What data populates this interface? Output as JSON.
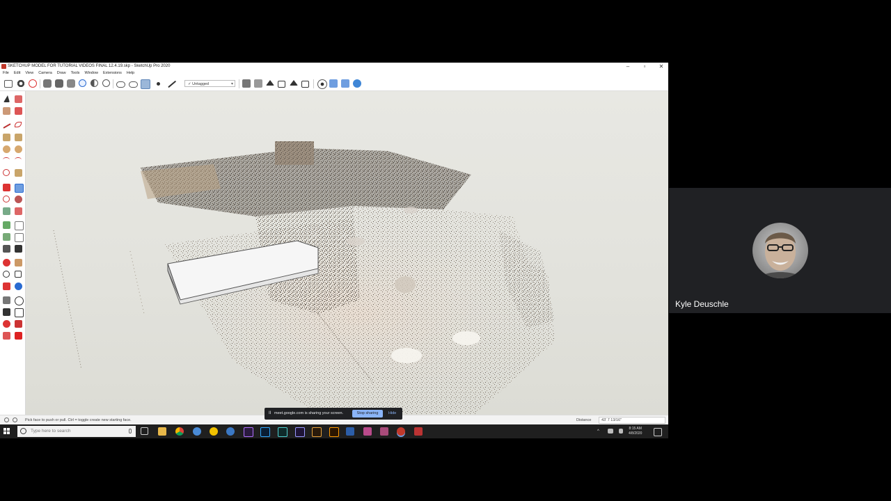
{
  "window": {
    "title": "SKETCHUP MODEL FOR TUTORIAL VIDEOS FINAL 12.4.19.skp - SketchUp Pro 2020",
    "controls": {
      "minimize": "–",
      "maximize": "▫",
      "close": "✕"
    }
  },
  "menu": [
    "File",
    "Edit",
    "View",
    "Camera",
    "Draw",
    "Tools",
    "Window",
    "Extensions",
    "Help"
  ],
  "toolbar": {
    "tag_select_value": "Untagged",
    "tag_select_check": "✓"
  },
  "status_bar": {
    "hint": "Pick face to push or pull. Ctrl = toggle create new starting face.",
    "distance_label": "Distance",
    "distance_value": "43' 7 13/16\""
  },
  "share_banner": {
    "pause_icon": "II",
    "message": "meet.google.com is sharing your screen.",
    "stop_label": "Stop sharing",
    "hide_label": "Hide"
  },
  "taskbar": {
    "search_placeholder": "Type here to search",
    "clock_time": "8:15 AM",
    "clock_date": "4/8/2020",
    "tray_chevron": "^"
  },
  "participant": {
    "name": "Kyle Deuschle"
  },
  "colors": {
    "sketchup_red": "#c0392b",
    "meet_blue": "#8ab4f8",
    "tile_bg": "#202124"
  }
}
